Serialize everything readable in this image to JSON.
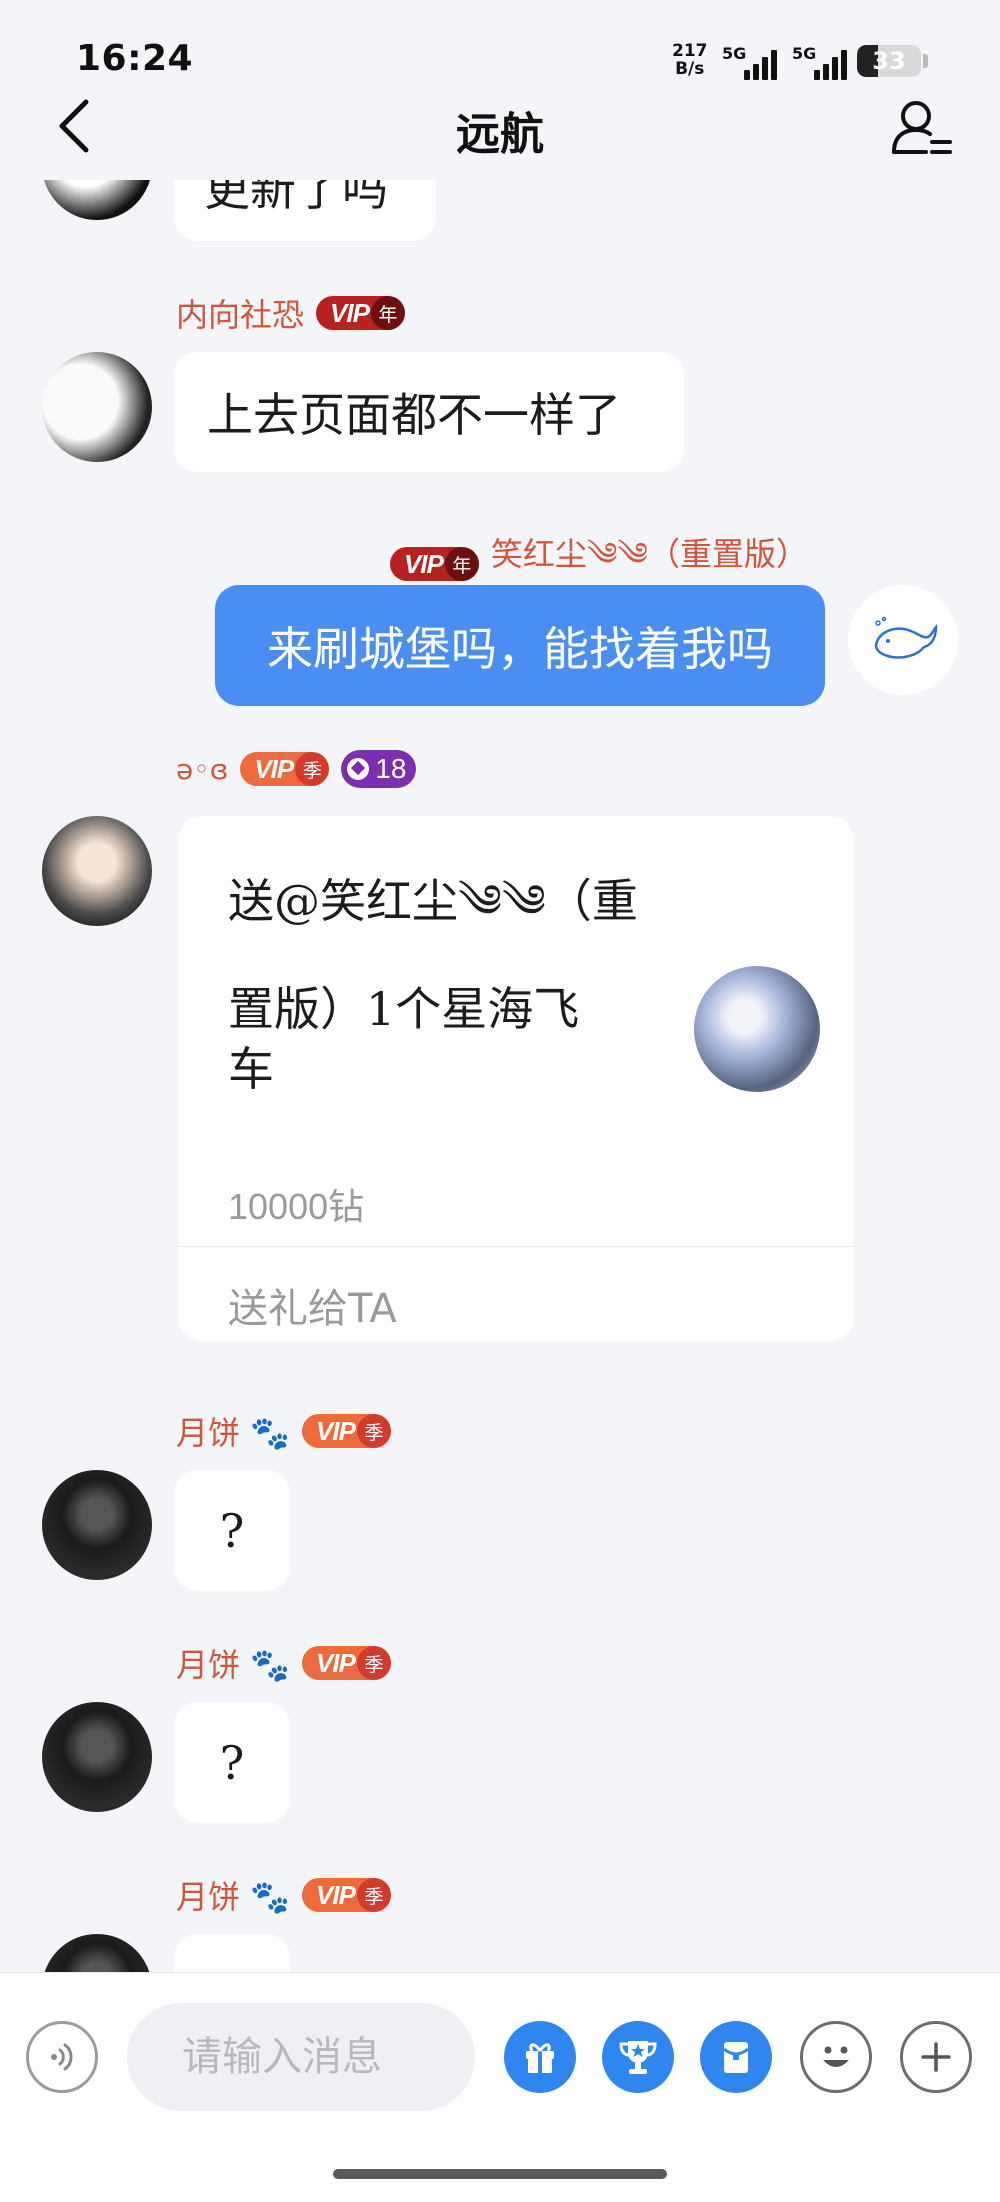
{
  "status_bar": {
    "time": "16:24",
    "net_speed_value": "217",
    "net_speed_unit": "B/s",
    "signal1_label": "5G",
    "signal2_label": "5G",
    "battery": "33",
    "battery_level": 0.33
  },
  "nav": {
    "title": "远航"
  },
  "messages": [
    {
      "type": "text",
      "side": "left",
      "text": "更新了吗",
      "partial": true
    },
    {
      "type": "text",
      "side": "left",
      "name": "内向社恐",
      "vip": "VIP",
      "vip_tag": "年",
      "text": "上去页面都不一样了"
    },
    {
      "type": "text",
      "side": "right",
      "name": "笑红尘༄༄（重置版）",
      "vip": "VIP",
      "vip_tag": "年",
      "text": "来刷城堡吗，能找着我吗"
    },
    {
      "type": "gift",
      "side": "left",
      "name": "ə◦ɞ",
      "vip": "VIP",
      "vip_tag": "季",
      "level": "18",
      "gift_line1": "送@笑红尘༄༄（重",
      "gift_line2": "置版）1个星海飞",
      "gift_line3": "车",
      "price": "10000钻",
      "action": "送礼给TA"
    },
    {
      "type": "text",
      "side": "left",
      "name": "月饼 🐾",
      "vip": "VIP",
      "vip_tag": "季",
      "text": "?"
    },
    {
      "type": "text",
      "side": "left",
      "name": "月饼 🐾",
      "vip": "VIP",
      "vip_tag": "季",
      "text": "?"
    },
    {
      "type": "text",
      "side": "left",
      "name": "月饼 🐾",
      "vip": "VIP",
      "vip_tag": "季",
      "text": "",
      "partial": true
    }
  ],
  "input": {
    "placeholder": "请输入消息"
  },
  "toolbar_icons": [
    "voice-icon",
    "gift-icon",
    "trophy-icon",
    "red-packet-icon",
    "emoji-icon",
    "plus-icon"
  ],
  "colors": {
    "background": "#f3f5f9",
    "self_bubble": "#4b8ef3",
    "name_text": "#d2553c",
    "toolbar_blue": "#2f86ee"
  }
}
